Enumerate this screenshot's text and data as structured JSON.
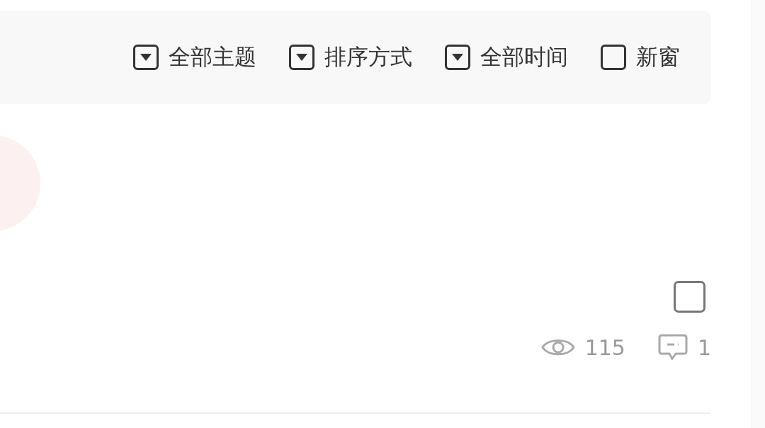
{
  "filters": [
    {
      "kind": "dropdown",
      "label": "全部主题"
    },
    {
      "kind": "dropdown",
      "label": "排序方式"
    },
    {
      "kind": "dropdown",
      "label": "全部时间"
    },
    {
      "kind": "checkbox",
      "label": "新窗",
      "checked": false
    }
  ],
  "post": {
    "checked": false,
    "views": "115",
    "comments": "1"
  }
}
